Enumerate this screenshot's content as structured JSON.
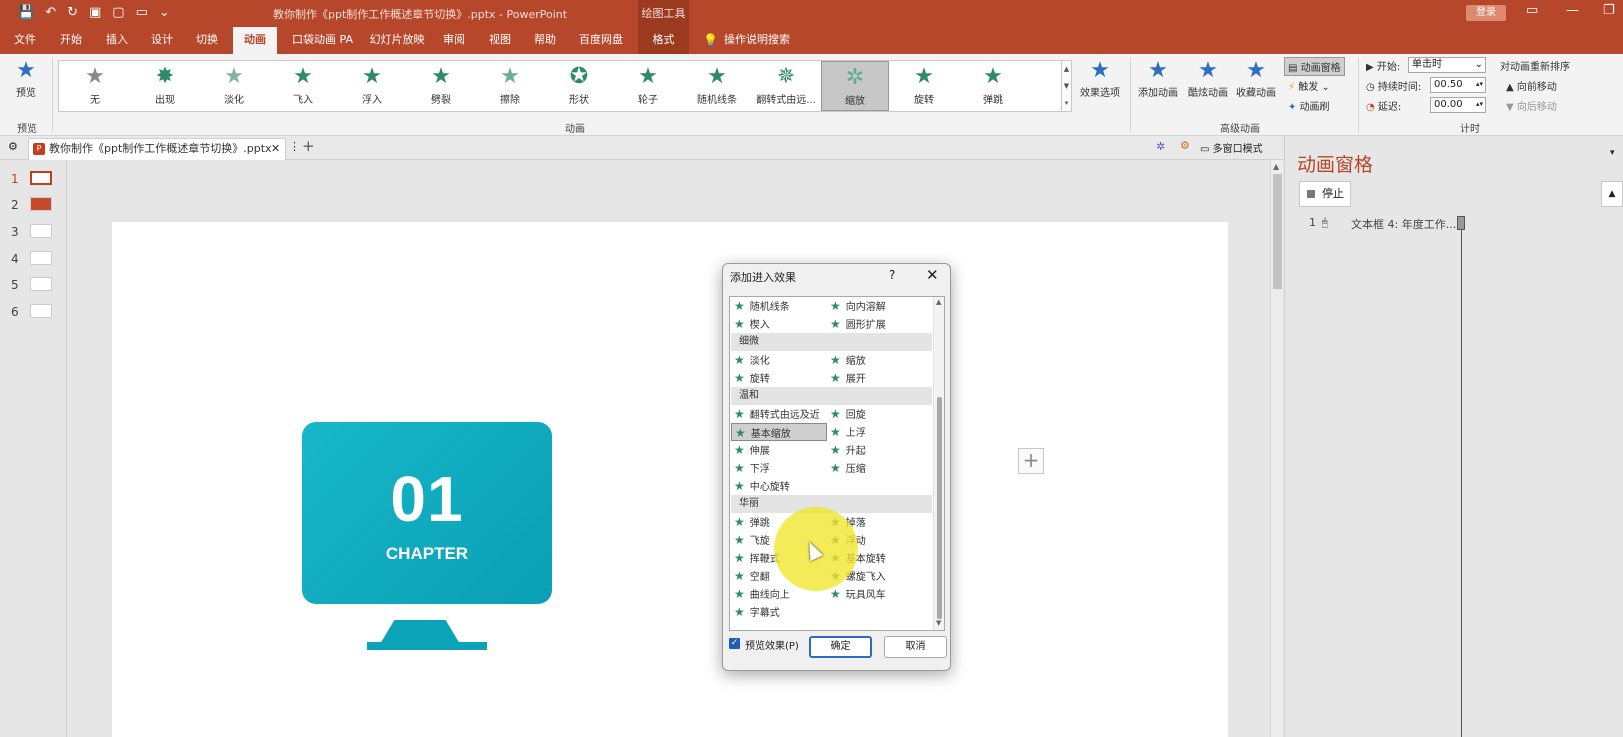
{
  "colors": {
    "brand": "#b7472a",
    "accent_star": "#2f8a68",
    "slide_teal": "#0fa9bd",
    "checkbox": "#1f5fb3"
  },
  "titlebar": {
    "doc_title": "教你制作《ppt制作工作概述章节切换》.pptx  -  PowerPoint",
    "context_tool": "绘图工具",
    "login": "登录",
    "icons": [
      "save-icon",
      "undo-icon",
      "redo-icon",
      "slideshow-icon",
      "new-icon",
      "open-icon",
      "customize-icon"
    ]
  },
  "tabs": [
    "文件",
    "开始",
    "插入",
    "设计",
    "切换",
    "动画",
    "口袋动画 PA",
    "幻灯片放映",
    "审阅",
    "视图",
    "帮助",
    "百度网盘",
    "格式",
    "操作说明搜索"
  ],
  "active_tab": "动画",
  "ribbon": {
    "preview": {
      "label": "预览",
      "group": "预览"
    },
    "gallery": {
      "group": "动画",
      "items": [
        "无",
        "出现",
        "淡化",
        "飞入",
        "浮入",
        "劈裂",
        "擦除",
        "形状",
        "轮子",
        "随机线条",
        "翻转式由远...",
        "缩放",
        "旋转",
        "弹跳"
      ],
      "selected": "缩放"
    },
    "effect_options": "效果选项",
    "advanced": {
      "group": "高级动画",
      "add_animation": "添加动画",
      "animation_painter": "动画刷",
      "favorite": "收藏动画",
      "paint_brush": "刷",
      "pane": "动画窗格",
      "trigger": "触发",
      "anim_brush": "动画刷",
      "brush_label": "酷炫动画"
    },
    "timing": {
      "group": "计时",
      "start_label": "开始:",
      "start_value": "单击时",
      "duration_label": "持续时间:",
      "duration_value": "00.50",
      "delay_label": "延迟:",
      "delay_value": "00.00",
      "reorder": "对动画重新排序",
      "move_forward": "向前移动",
      "move_back": "向后移动"
    }
  },
  "docbar": {
    "tab_title": "教你制作《ppt制作工作概述章节切换》.pptx",
    "multiwindow": "多窗口模式"
  },
  "thumbs": [
    {
      "num": "1"
    },
    {
      "num": "2"
    },
    {
      "num": "3"
    },
    {
      "num": "4"
    },
    {
      "num": "5"
    },
    {
      "num": "6"
    }
  ],
  "slide": {
    "number": "01",
    "chapter": "CHAPTER"
  },
  "anipane": {
    "title": "动画窗格",
    "stop": "停止",
    "item_index": "1",
    "item_label": "文本框 4: 年度工作..."
  },
  "dialog": {
    "title": "添加进入效果",
    "help": "?",
    "close": "✕",
    "rows": [
      {
        "a": "随机线条",
        "b": "向内溶解"
      },
      {
        "a": "楔入",
        "b": "圆形扩展"
      },
      {
        "cat": "细微"
      },
      {
        "a": "淡化",
        "b": "缩放"
      },
      {
        "a": "旋转",
        "b": "展开"
      },
      {
        "cat": "温和"
      },
      {
        "a": "翻转式由远及近",
        "b": "回旋"
      },
      {
        "a": "基本缩放",
        "b": "上浮"
      },
      {
        "a": "伸展",
        "b": "升起"
      },
      {
        "a": "下浮",
        "b": "压缩"
      },
      {
        "a": "中心旋转"
      },
      {
        "cat": "华丽"
      },
      {
        "a": "弹跳",
        "b": "掉落"
      },
      {
        "a": "飞旋",
        "b": "浮动"
      },
      {
        "a": "挥鞭式",
        "b": "基本旋转"
      },
      {
        "a": "空翻",
        "b": "螺旋飞入"
      },
      {
        "a": "曲线向上",
        "b": "玩具风车"
      },
      {
        "a": "字幕式"
      }
    ],
    "selected": "基本缩放",
    "preview_checkbox": "预览效果(P)",
    "preview_checked": true,
    "ok": "确定",
    "cancel": "取消"
  }
}
